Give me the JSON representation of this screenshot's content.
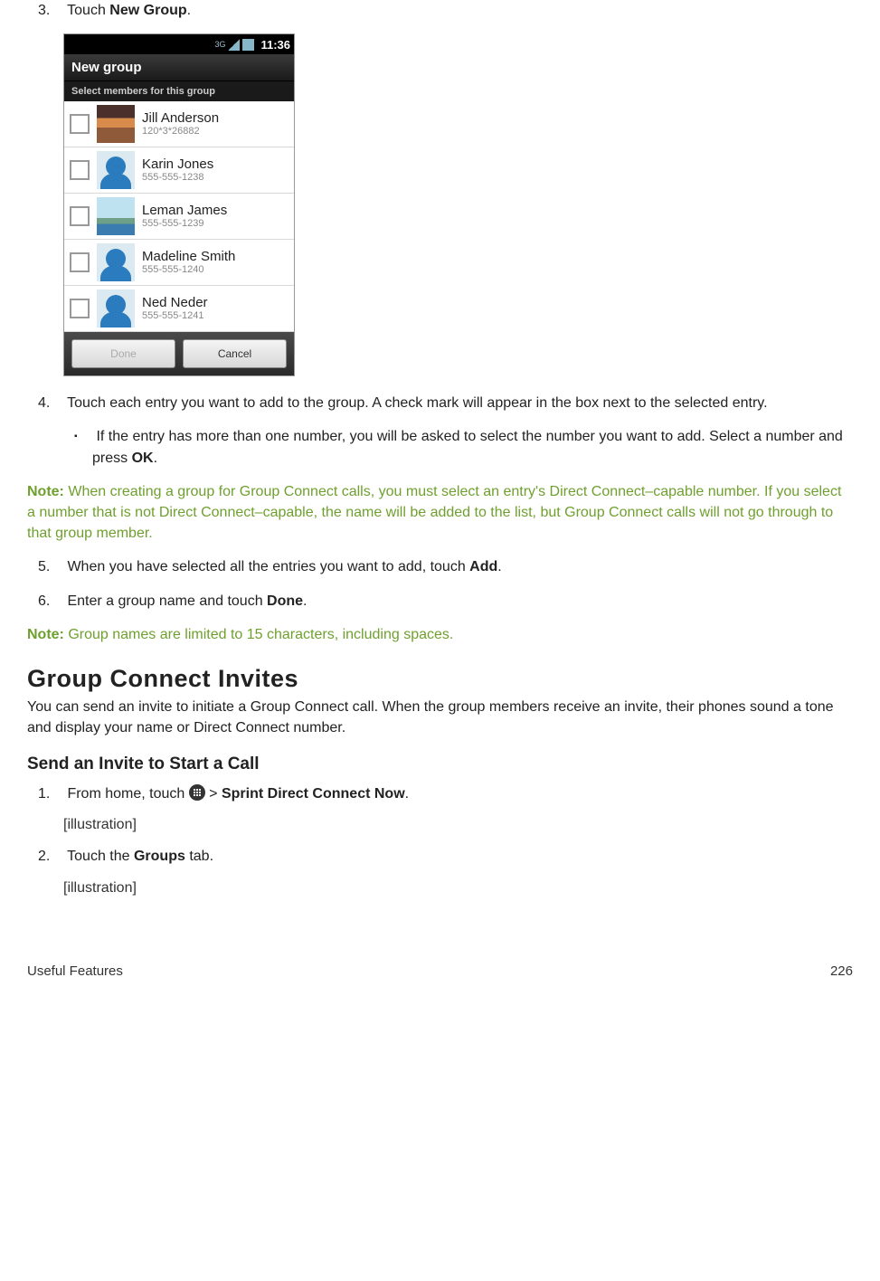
{
  "step3": {
    "num": "3.",
    "pre": "Touch ",
    "bold": "New Group",
    "post": "."
  },
  "phone": {
    "status_time": "11:36",
    "status_small": "3G",
    "title": "New group",
    "subtitle": "Select members for this group",
    "contacts": [
      {
        "name": "Jill Anderson",
        "num": "120*3*26882",
        "avatar": "sunset"
      },
      {
        "name": "Karin Jones",
        "num": "555-555-1238",
        "avatar": "sil"
      },
      {
        "name": "Leman James",
        "num": "555-555-1239",
        "avatar": "landscape"
      },
      {
        "name": "Madeline Smith",
        "num": "555-555-1240",
        "avatar": "sil"
      },
      {
        "name": "Ned Neder",
        "num": "555-555-1241",
        "avatar": "sil"
      }
    ],
    "done": "Done",
    "cancel": "Cancel"
  },
  "step4": {
    "num": "4.",
    "text": "Touch each entry you want to add to the group. A check mark will appear in the box next to the selected entry."
  },
  "step4bullet": {
    "pre": "If the entry has more than one number, you will be asked to select the number you want to add.  Select a number and press ",
    "bold": "OK",
    "post": "."
  },
  "note1": {
    "label": "Note:",
    "text": " When creating a group for Group Connect calls, you must select an entry's Direct Connect–capable number. If you select a number that is not Direct Connect–capable, the name will be added to the list, but Group Connect calls will not go through to that group member."
  },
  "step5": {
    "num": "5.",
    "pre": "When you have selected all the entries you want to add, touch ",
    "bold": "Add",
    "post": "."
  },
  "step6": {
    "num": "6.",
    "pre": "Enter a group name and touch ",
    "bold": "Done",
    "post": "."
  },
  "note2": {
    "label": "Note:",
    "text": " Group names are limited to 15 characters, including spaces."
  },
  "heading": "Group Connect Invites",
  "intro": "You can send an invite to initiate a Group Connect call. When the group members receive an invite, their phones sound a tone and display your name or Direct Connect number.",
  "subheading": "Send an Invite to Start a Call",
  "sstep1": {
    "num": "1.",
    "pre": "From home, touch ",
    "mid": " > ",
    "bold": "Sprint Direct Connect Now",
    "post": "."
  },
  "illus": "[illustration]",
  "sstep2": {
    "num": "2.",
    "pre": "Touch the ",
    "bold": "Groups",
    "post": " tab."
  },
  "footer_left": "Useful Features",
  "footer_right": "226"
}
